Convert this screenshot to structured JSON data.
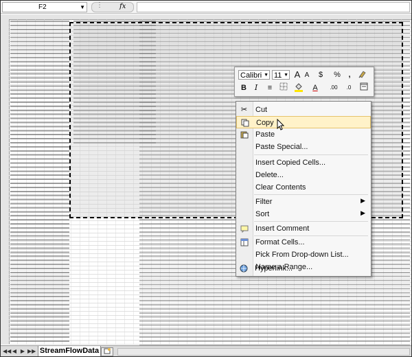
{
  "formula_bar": {
    "cell_ref": "F2",
    "fx_label": "fx",
    "dots": "⋮"
  },
  "mini_toolbar": {
    "font": "Calibri",
    "size": "11",
    "grow_font": "A",
    "shrink_font": "A",
    "currency": "$",
    "percent": "%",
    "comma": ",",
    "bold": "B",
    "italic": "I",
    "font_color": "A",
    "increase_decimal": ".00",
    "decrease_decimal": ".0"
  },
  "context_menu": {
    "items": [
      {
        "label": "Cut",
        "icon": "scissors-icon"
      },
      {
        "label": "Copy",
        "icon": "copy-icon"
      },
      {
        "label": "Paste",
        "icon": "paste-icon"
      },
      {
        "label": "Paste Special...",
        "icon": ""
      },
      {
        "label": "Insert Copied Cells...",
        "icon": ""
      },
      {
        "label": "Delete...",
        "icon": ""
      },
      {
        "label": "Clear Contents",
        "icon": ""
      },
      {
        "label": "Filter",
        "icon": "",
        "submenu": true
      },
      {
        "label": "Sort",
        "icon": "",
        "submenu": true
      },
      {
        "label": "Insert Comment",
        "icon": "comment-icon"
      },
      {
        "label": "Format Cells...",
        "icon": "format-cells-icon"
      },
      {
        "label": "Pick From Drop-down List...",
        "icon": ""
      },
      {
        "label": "Name a Range...",
        "icon": ""
      },
      {
        "label": "Hyperlink...",
        "icon": "hyperlink-icon"
      }
    ],
    "highlighted": "Copy",
    "submenu_arrow": "▶"
  },
  "sheet_tabs": {
    "active": "StreamFlowData",
    "nav": [
      "◀◀",
      "◀",
      "▶",
      "▶▶"
    ]
  },
  "colors": {
    "menu_highlight": "#fff2c9",
    "selection_border": "#000000"
  }
}
